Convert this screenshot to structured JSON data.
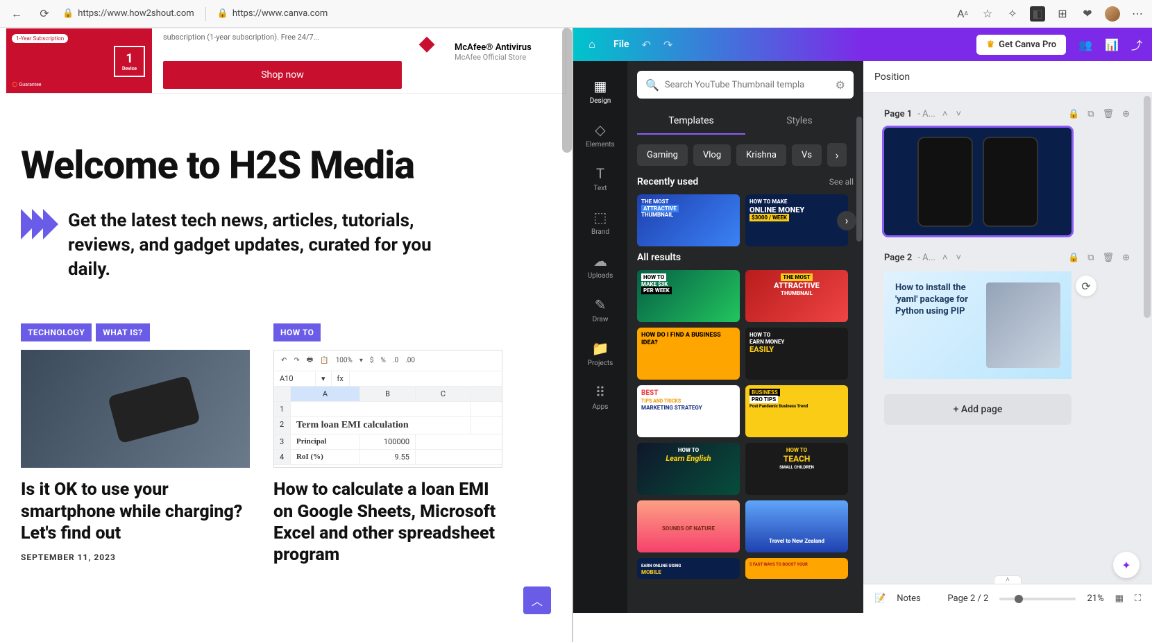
{
  "browser": {
    "url1": "https://www.how2shout.com",
    "url2": "https://www.canva.com"
  },
  "ad": {
    "subscription": "1-Year Subscription",
    "device": "1",
    "device_label": "Device",
    "subtext": "subscription (1-year subscription). Free 24/7...",
    "shop": "Shop now",
    "brand": "McAfee® Antivirus",
    "store": "McAfee Official Store"
  },
  "h2s": {
    "title": "Welcome to H2S Media",
    "subtitle": "Get the latest tech news, articles, tutorials, reviews, and gadget updates, curated for you daily.",
    "tags": {
      "tech": "TECHNOLOGY",
      "what": "WHAT IS?",
      "howto": "HOW TO"
    },
    "art1": {
      "title": "Is it OK to use your smartphone while charging? Let's find out",
      "date": "SEPTEMBER 11, 2023"
    },
    "art2": {
      "title": "How to calculate a loan EMI on Google Sheets, Microsoft Excel and other spreadsheet program"
    },
    "sheet": {
      "zoom": "100%",
      "a10": "A10",
      "fx": "fx",
      "colA": "A",
      "colB": "B",
      "colC": "C",
      "r2a": "Term loan EMI calculation",
      "r3a": "Principal",
      "r3b": "100000",
      "r4a": "RoI (%)",
      "r4b": "9.55"
    }
  },
  "canva": {
    "file": "File",
    "pro": "Get Canva Pro",
    "rail": {
      "design": "Design",
      "elements": "Elements",
      "text": "Text",
      "brand": "Brand",
      "uploads": "Uploads",
      "draw": "Draw",
      "projects": "Projects",
      "apps": "Apps"
    },
    "search_placeholder": "Search YouTube Thumbnail templa",
    "tabs": {
      "templates": "Templates",
      "styles": "Styles"
    },
    "chips": {
      "gaming": "Gaming",
      "vlog": "Vlog",
      "krishna": "Krishna",
      "vs": "Vs"
    },
    "recent": "Recently used",
    "seeall": "See all",
    "all": "All results",
    "thumbs": {
      "t1a": "THE MOST",
      "t1b": "ATTRACTIVE",
      "t1c": "THUMBNAIL",
      "t2a": "HOW TO MAKE",
      "t2b": "ONLINE MONEY",
      "t2c": "$3000 / WEEK",
      "t3a": "HOW TO",
      "t3b": "MAKE $3K",
      "t3c": "PER WEEK",
      "t4a": "THE MOST",
      "t4b": "ATTRACTIVE",
      "t4c": "THUMBNAIL",
      "t5a": "HOW DO I FIND A BUSINESS IDEA?",
      "t6a": "HOW TO",
      "t6b": "EARN MONEY",
      "t6c": "EASILY",
      "t7a": "BEST",
      "t7b": "TIPS AND TRICKS",
      "t7c": "MARKETING STRATEGY",
      "t8a": "BUSINESS",
      "t8b": "PRO TIPS",
      "t8c": "Post Pandemic Business Trend",
      "t9a": "HOW TO",
      "t9b": "Learn English",
      "t10a": "HOW TO",
      "t10b": "TEACH",
      "t10c": "SMALL CHILDREN",
      "t11a": "SOUNDS OF NATURE",
      "t12a": "Travel to New Zealand",
      "t13a": "EARN ONLINE USING",
      "t13b": "MOBILE",
      "t14a": "5 FAST WAYS TO BOOST YOUR"
    },
    "position": "Position",
    "page1": "Page 1",
    "page1sub": "- A...",
    "page2": "Page 2",
    "page2sub": "- A...",
    "page2_text": "How to install the 'yaml' package for Python using PIP",
    "addpage": "+ Add page",
    "notes": "Notes",
    "paging": "Page 2 / 2",
    "zoom": "21%"
  }
}
